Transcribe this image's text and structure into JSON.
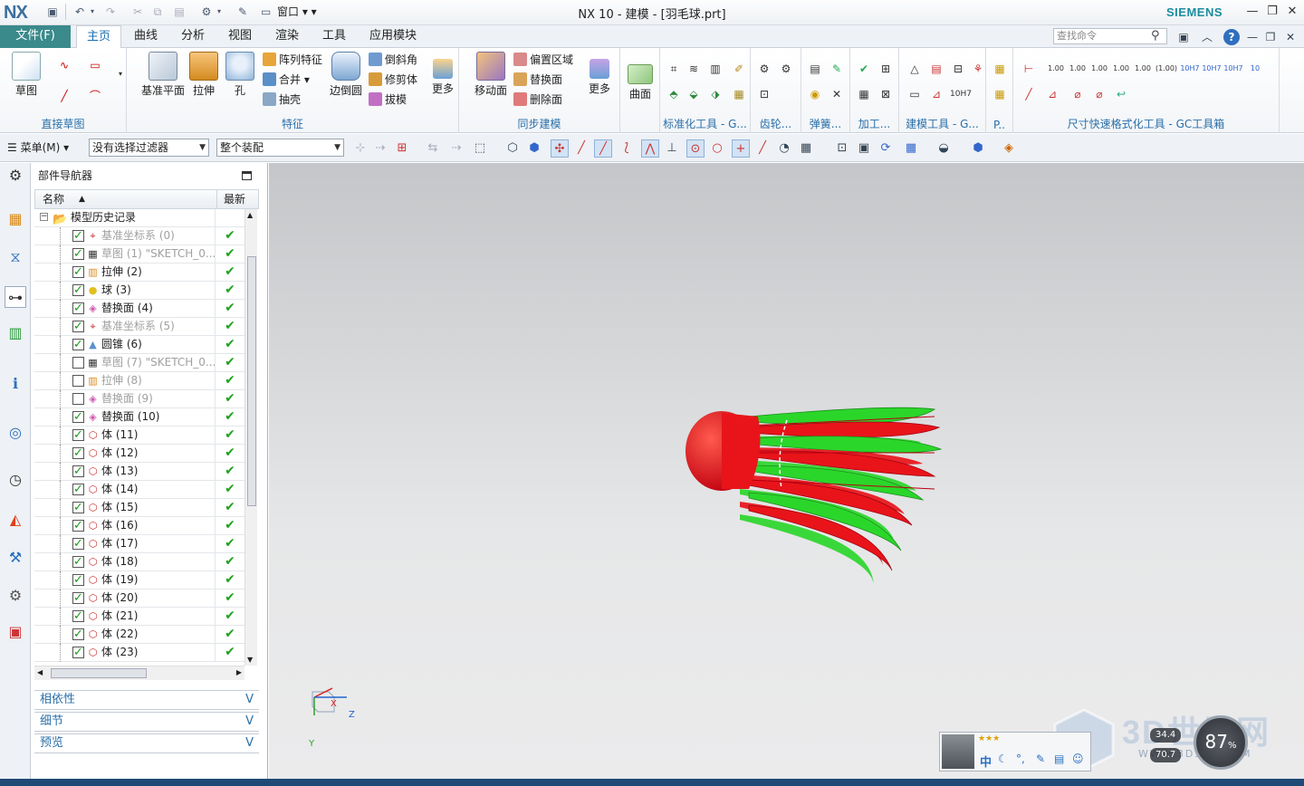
{
  "app": {
    "logo": "NX",
    "title": "NX 10 - 建模 - [羽毛球.prt]",
    "brand": "SIEMENS",
    "window_menu": "窗口"
  },
  "tabs": {
    "file": "文件(F)",
    "items": [
      "主页",
      "曲线",
      "分析",
      "视图",
      "渲染",
      "工具",
      "应用模块"
    ],
    "active": 0,
    "search_placeholder": "查找命令"
  },
  "ribbon": {
    "sketch_group": {
      "label": "直接草图",
      "sketch": "草图"
    },
    "feature_group": {
      "label": "特征",
      "datum_plane": "基准平面",
      "extrude": "拉伸",
      "hole": "孔",
      "pattern": "阵列特征",
      "unite": "合并",
      "shell": "抽壳",
      "edge_blend": "边倒圆",
      "chamfer": "倒斜角",
      "trim_body": "修剪体",
      "draft": "拔模",
      "more": "更多"
    },
    "sync_group": {
      "label": "同步建模",
      "move_face": "移动面",
      "offset_region": "偏置区域",
      "replace_face": "替换面",
      "delete_face": "删除面",
      "more": "更多"
    },
    "surface": {
      "label": "曲面"
    },
    "extra_groups": [
      "标准化工具 - G...",
      "齿轮...",
      "弹簧...",
      "加工...",
      "建模工具 - G...",
      "P..",
      "尺寸快速格式化工具 - GC工具箱"
    ],
    "tolerance_labels": [
      "1.00",
      "1.00",
      "1.00",
      "1.00",
      "1.00",
      "(1.00)",
      "10H7",
      "10H7",
      "10H7",
      "10"
    ]
  },
  "command_bar": {
    "menu": "菜单(M)",
    "filter": "没有选择过滤器",
    "scope": "整个装配"
  },
  "navigator": {
    "title": "部件导航器",
    "col_name": "名称",
    "col_latest": "最新",
    "root": "模型历史记录",
    "rows": [
      {
        "label": "基准坐标系 (0)",
        "checked": true,
        "dim": true,
        "icon": "datum-csys-icon"
      },
      {
        "label": "草图 (1) \"SKETCH_0...",
        "checked": true,
        "dim": true,
        "icon": "sketch-icon"
      },
      {
        "label": "拉伸 (2)",
        "checked": true,
        "dim": false,
        "icon": "extrude-icon"
      },
      {
        "label": "球 (3)",
        "checked": true,
        "dim": false,
        "icon": "sphere-icon"
      },
      {
        "label": "替换面 (4)",
        "checked": true,
        "dim": false,
        "icon": "replace-face-icon"
      },
      {
        "label": "基准坐标系 (5)",
        "checked": true,
        "dim": true,
        "icon": "datum-csys-icon"
      },
      {
        "label": "圆锥 (6)",
        "checked": true,
        "dim": false,
        "icon": "cone-icon"
      },
      {
        "label": "草图 (7) \"SKETCH_0...",
        "checked": false,
        "dim": true,
        "icon": "sketch-icon"
      },
      {
        "label": "拉伸 (8)",
        "checked": false,
        "dim": true,
        "icon": "extrude-icon"
      },
      {
        "label": "替换面 (9)",
        "checked": false,
        "dim": true,
        "icon": "replace-face-icon"
      },
      {
        "label": "替换面 (10)",
        "checked": true,
        "dim": false,
        "icon": "replace-face-icon"
      },
      {
        "label": "体 (11)",
        "checked": true,
        "dim": false,
        "icon": "body-icon"
      },
      {
        "label": "体 (12)",
        "checked": true,
        "dim": false,
        "icon": "body-icon"
      },
      {
        "label": "体 (13)",
        "checked": true,
        "dim": false,
        "icon": "body-icon"
      },
      {
        "label": "体 (14)",
        "checked": true,
        "dim": false,
        "icon": "body-icon"
      },
      {
        "label": "体 (15)",
        "checked": true,
        "dim": false,
        "icon": "body-icon"
      },
      {
        "label": "体 (16)",
        "checked": true,
        "dim": false,
        "icon": "body-icon"
      },
      {
        "label": "体 (17)",
        "checked": true,
        "dim": false,
        "icon": "body-icon"
      },
      {
        "label": "体 (18)",
        "checked": true,
        "dim": false,
        "icon": "body-icon"
      },
      {
        "label": "体 (19)",
        "checked": true,
        "dim": false,
        "icon": "body-icon"
      },
      {
        "label": "体 (20)",
        "checked": true,
        "dim": false,
        "icon": "body-icon"
      },
      {
        "label": "体 (21)",
        "checked": true,
        "dim": false,
        "icon": "body-icon"
      },
      {
        "label": "体 (22)",
        "checked": true,
        "dim": false,
        "icon": "body-icon"
      },
      {
        "label": "体 (23)",
        "checked": true,
        "dim": false,
        "icon": "body-icon"
      }
    ],
    "sections": [
      "相依性",
      "细节",
      "预览"
    ]
  },
  "triad": {
    "x": "X",
    "y": "Y",
    "z": "Z"
  },
  "tray": {
    "ime": "中"
  },
  "overlay": {
    "watermark": "3D世界网",
    "url": "WWW.3DSJW.COM",
    "cpu_percent": "87",
    "speed_up": "34.4",
    "speed_down": "70.7"
  },
  "colors": {
    "accent": "#3a8a8c",
    "shuttle_red": "#e8141a",
    "shuttle_green": "#2bd62b",
    "check_green": "#1fa31f"
  }
}
